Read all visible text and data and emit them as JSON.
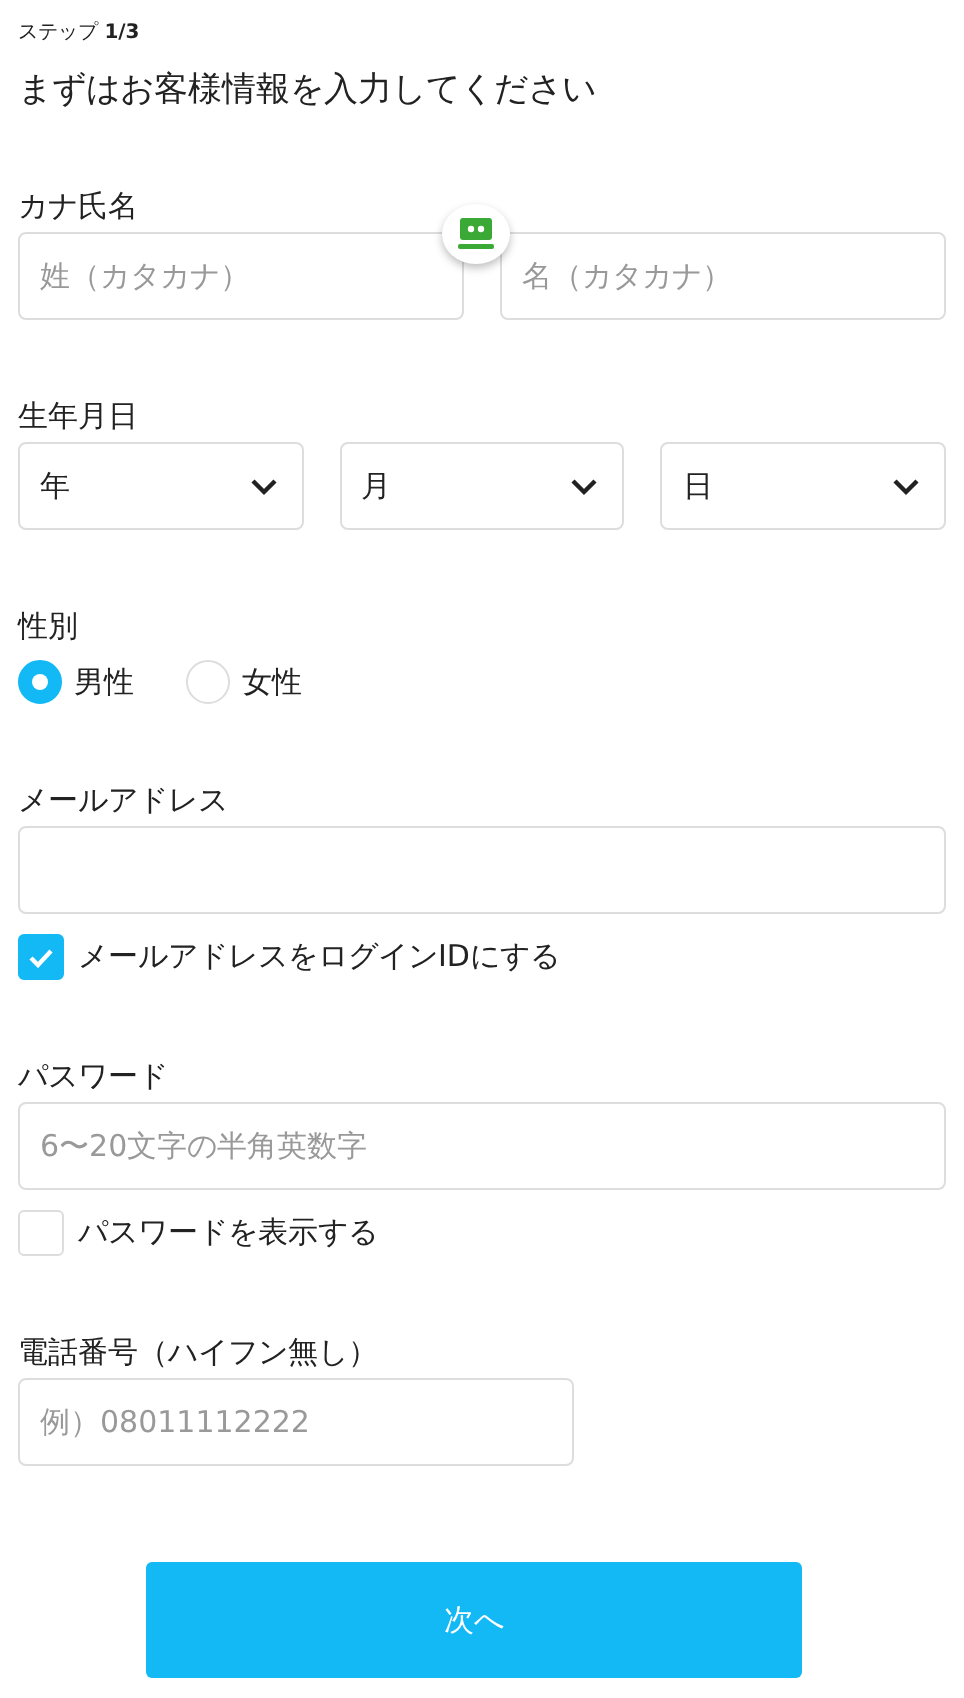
{
  "step": "ステップ **1/3**",
  "title": "まずはお客様情報を入力してください",
  "sections": [
    {
      "kind": "pair",
      "label": "カナ氏名",
      "inputs": [
        {
          "placeholder": "姓（カタカナ）"
        },
        {
          "placeholder": "名（カタカナ）"
        }
      ]
    },
    {
      "kind": "selects",
      "label": "生年月日",
      "selects": [
        {
          "value": "年"
        },
        {
          "value": "月"
        },
        {
          "value": "日"
        }
      ]
    },
    {
      "kind": "radio",
      "label": "性別",
      "options": [
        {
          "label": "男性",
          "selected": true
        },
        {
          "label": "女性",
          "selected": false
        }
      ]
    },
    {
      "kind": "text",
      "label": "メールアドレス",
      "checkbox": {
        "label": "メールアドレスをログインIDにする",
        "checked": true
      }
    },
    {
      "kind": "text",
      "label": "パスワード",
      "input": {
        "placeholder": "6〜20文字の半角英数字"
      },
      "checkbox": {
        "label": "パスワードを表示する",
        "checked": false
      }
    },
    {
      "kind": "short",
      "label": "電話番号（ハイフン無し）",
      "input": {
        "placeholder": "例）08011112222"
      }
    }
  ],
  "submit": "次へ"
}
